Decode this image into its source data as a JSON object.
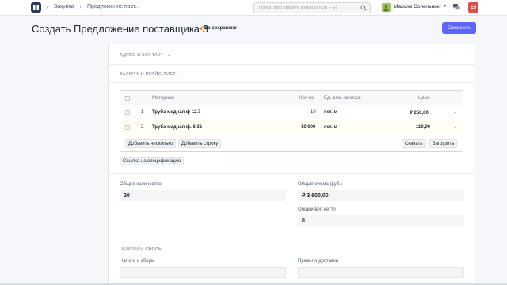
{
  "navbar": {
    "breadcrumbs": [
      "Закупка",
      "Предложение пост..."
    ],
    "search_placeholder": "Поиск либо введите команду (Ctrl + G)",
    "user_name": "Максим Сопельник",
    "notifications_count": "15"
  },
  "header": {
    "title": "Создать Предложение поставщика 3",
    "status": "Не сохранено",
    "save_label": "Сохранить"
  },
  "sections": {
    "address": "АДРЕС И КОНТАКТ",
    "currency": "ВАЛЮТА И ПРАЙС-ЛИСТ",
    "taxes": "НАЛОГИ И СБОРЫ"
  },
  "items_table": {
    "columns": [
      "Материал",
      "Кол-во",
      "Ед. изм. запасов",
      "Цена"
    ],
    "rows": [
      {
        "idx": "1",
        "item": "Труба медная ф 12.7",
        "qty": "10",
        "uom": "пог. м",
        "rate": "₽ 250,00"
      },
      {
        "idx": "2",
        "item": "Труба медная ф. 6.36",
        "qty": "10,000",
        "uom": "пог. м",
        "rate": "110,00"
      }
    ],
    "buttons": {
      "add_multiple": "Добавить несколько",
      "add_row": "Добавить строку",
      "download": "Скачать",
      "upload": "Загрузить"
    }
  },
  "spec_link_label": "Ссылка на спецификацию",
  "totals": {
    "total_qty_label": "Общее количество",
    "total_qty": "20",
    "total_label": "Общая сумма (руб.)",
    "total": "₽ 3.600,00",
    "net_weight_label": "Общий вес нетто",
    "net_weight": "0"
  },
  "taxes": {
    "taxes_label": "Налоги и сборы",
    "shipping_rule_label": "Правило доставки"
  },
  "colors": {
    "primary": "#5e64ff",
    "status_dot": "#f0a030",
    "notification": "#e24c4c",
    "logo": "#2d3a5e"
  }
}
